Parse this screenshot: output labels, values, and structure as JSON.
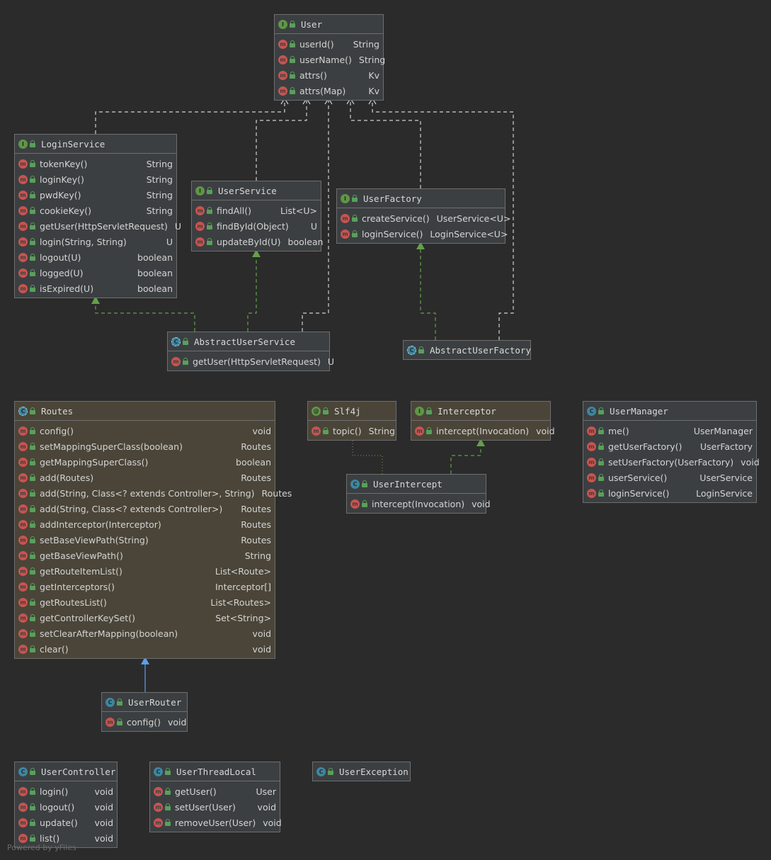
{
  "nodes": [
    {
      "id": "User",
      "kind": "I",
      "kind_letter": "I",
      "title": "User",
      "icon": "interface-icon",
      "members": [
        {
          "name": "userId()",
          "type": "String"
        },
        {
          "name": "userName()",
          "type": "String"
        },
        {
          "name": "attrs()",
          "type": "Kv"
        },
        {
          "name": "attrs(Map)",
          "type": "Kv"
        }
      ]
    },
    {
      "id": "LoginService",
      "kind": "I",
      "kind_letter": "I",
      "title": "LoginService",
      "icon": "interface-icon",
      "members": [
        {
          "name": "tokenKey()",
          "type": "String"
        },
        {
          "name": "loginKey()",
          "type": "String"
        },
        {
          "name": "pwdKey()",
          "type": "String"
        },
        {
          "name": "cookieKey()",
          "type": "String"
        },
        {
          "name": "getUser(HttpServletRequest)",
          "type": "U"
        },
        {
          "name": "login(String, String)",
          "type": "U"
        },
        {
          "name": "logout(U)",
          "type": "boolean"
        },
        {
          "name": "logged(U)",
          "type": "boolean"
        },
        {
          "name": "isExpired(U)",
          "type": "boolean"
        }
      ]
    },
    {
      "id": "UserService",
      "kind": "I",
      "kind_letter": "I",
      "title": "UserService",
      "icon": "interface-icon",
      "members": [
        {
          "name": "findAll()",
          "type": "List<U>"
        },
        {
          "name": "findById(Object)",
          "type": "U"
        },
        {
          "name": "updateById(U)",
          "type": "boolean"
        }
      ]
    },
    {
      "id": "UserFactory",
      "kind": "I",
      "kind_letter": "I",
      "title": "UserFactory",
      "icon": "interface-icon",
      "members": [
        {
          "name": "createService()",
          "type": "UserService<U>"
        },
        {
          "name": "loginService()",
          "type": "LoginService<U>"
        }
      ]
    },
    {
      "id": "AbstractUserService",
      "kind": "A",
      "kind_letter": "C",
      "title": "AbstractUserService",
      "icon": "abstract-class-icon",
      "members": [
        {
          "name": "getUser(HttpServletRequest)",
          "type": "U"
        }
      ]
    },
    {
      "id": "AbstractUserFactory",
      "kind": "A",
      "kind_letter": "C",
      "title": "AbstractUserFactory",
      "icon": "abstract-class-icon",
      "members": []
    },
    {
      "id": "Routes",
      "kind": "A",
      "kind_letter": "C",
      "title": "Routes",
      "icon": "abstract-class-icon",
      "members": [
        {
          "name": "config()",
          "type": "void"
        },
        {
          "name": "setMappingSuperClass(boolean)",
          "type": "Routes"
        },
        {
          "name": "getMappingSuperClass()",
          "type": "boolean"
        },
        {
          "name": "add(Routes)",
          "type": "Routes"
        },
        {
          "name": "add(String, Class<? extends Controller>, String)",
          "type": "Routes"
        },
        {
          "name": "add(String, Class<? extends Controller>)",
          "type": "Routes"
        },
        {
          "name": "addInterceptor(Interceptor)",
          "type": "Routes"
        },
        {
          "name": "setBaseViewPath(String)",
          "type": "Routes"
        },
        {
          "name": "getBaseViewPath()",
          "type": "String"
        },
        {
          "name": "getRouteItemList()",
          "type": "List<Route>"
        },
        {
          "name": "getInterceptors()",
          "type": "Interceptor[]"
        },
        {
          "name": "getRoutesList()",
          "type": "List<Routes>"
        },
        {
          "name": "getControllerKeySet()",
          "type": "Set<String>"
        },
        {
          "name": "setClearAfterMapping(boolean)",
          "type": "void"
        },
        {
          "name": "clear()",
          "type": "void"
        }
      ]
    },
    {
      "id": "Slf4j",
      "kind": "AN",
      "kind_letter": "@",
      "title": "Slf4j",
      "icon": "annotation-icon",
      "members": [
        {
          "name": "topic()",
          "type": "String"
        }
      ]
    },
    {
      "id": "Interceptor",
      "kind": "I",
      "kind_letter": "I",
      "title": "Interceptor",
      "icon": "interface-icon",
      "members": [
        {
          "name": "intercept(Invocation)",
          "type": "void"
        }
      ]
    },
    {
      "id": "UserIntercept",
      "kind": "C",
      "kind_letter": "C",
      "title": "UserIntercept",
      "icon": "class-icon",
      "members": [
        {
          "name": "intercept(Invocation)",
          "type": "void"
        }
      ]
    },
    {
      "id": "UserManager",
      "kind": "C",
      "kind_letter": "C",
      "title": "UserManager",
      "icon": "class-icon",
      "members": [
        {
          "name": "me()",
          "type": "UserManager"
        },
        {
          "name": "getUserFactory()",
          "type": "UserFactory"
        },
        {
          "name": "setUserFactory(UserFactory)",
          "type": "void"
        },
        {
          "name": "userService()",
          "type": "UserService"
        },
        {
          "name": "loginService()",
          "type": "LoginService"
        }
      ]
    },
    {
      "id": "UserRouter",
      "kind": "C",
      "kind_letter": "C",
      "title": "UserRouter",
      "icon": "class-icon",
      "members": [
        {
          "name": "config()",
          "type": "void"
        }
      ]
    },
    {
      "id": "UserController",
      "kind": "C",
      "kind_letter": "C",
      "title": "UserController",
      "icon": "class-icon",
      "members": [
        {
          "name": "login()",
          "type": "void"
        },
        {
          "name": "logout()",
          "type": "void"
        },
        {
          "name": "update()",
          "type": "void"
        },
        {
          "name": "list()",
          "type": "void"
        }
      ]
    },
    {
      "id": "UserThreadLocal",
      "kind": "C",
      "kind_letter": "C",
      "title": "UserThreadLocal",
      "icon": "class-icon",
      "members": [
        {
          "name": "getUser()",
          "type": "User"
        },
        {
          "name": "setUser(User)",
          "type": "void"
        },
        {
          "name": "removeUser(User)",
          "type": "void"
        }
      ]
    },
    {
      "id": "UserException",
      "kind": "C",
      "kind_letter": "C",
      "title": "UserException",
      "icon": "class-icon",
      "members": []
    }
  ],
  "edges": [
    {
      "from": "LoginService",
      "to": "User",
      "type": "implements-dashed-white"
    },
    {
      "from": "UserService",
      "to": "User",
      "type": "implements-dashed-white"
    },
    {
      "from": "AbstractUserService",
      "to": "User",
      "type": "implements-dashed-white"
    },
    {
      "from": "UserFactory",
      "to": "User",
      "type": "implements-dashed-white"
    },
    {
      "from": "AbstractUserFactory",
      "to": "User",
      "type": "implements-dashed-white"
    },
    {
      "from": "AbstractUserService",
      "to": "LoginService",
      "type": "implements-dashed-green"
    },
    {
      "from": "AbstractUserService",
      "to": "UserService",
      "type": "implements-dashed-green"
    },
    {
      "from": "AbstractUserFactory",
      "to": "UserFactory",
      "type": "implements-dashed-green"
    },
    {
      "from": "UserIntercept",
      "to": "Interceptor",
      "type": "implements-dashed-green"
    },
    {
      "from": "UserIntercept",
      "to": "Slf4j",
      "type": "annotated-dotted"
    },
    {
      "from": "UserRouter",
      "to": "Routes",
      "type": "extends-solid-blue"
    }
  ],
  "colors": {
    "background": "#2b2b2b",
    "white_edge": "#cfcfcf",
    "green_edge": "#62a04b",
    "blue_edge": "#5b9ee8",
    "dotted_edge": "#8c7a52"
  },
  "footer": "Powered by yFiles"
}
